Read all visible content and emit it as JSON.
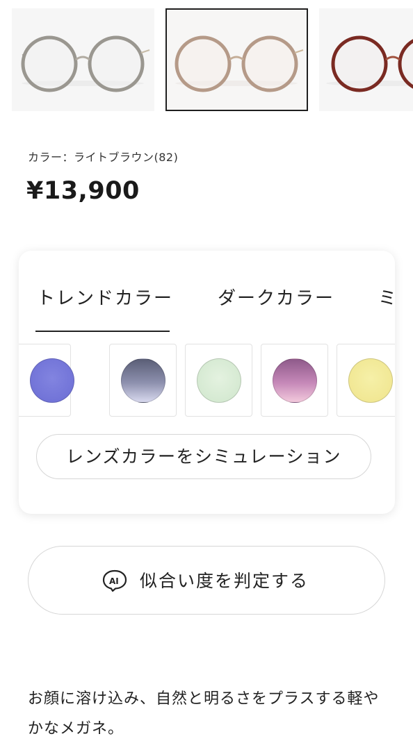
{
  "thumbnails": [
    {
      "name": "glasses-gray",
      "selected": false,
      "frame_color": "#9a9790"
    },
    {
      "name": "glasses-light-brown",
      "selected": true,
      "frame_color": "#b59a88"
    },
    {
      "name": "glasses-tortoise",
      "selected": false,
      "frame_color": "#7a2a22"
    }
  ],
  "product": {
    "color_line": "カラー：ライトブラウン(82)",
    "price": "¥13,900"
  },
  "lens_panel": {
    "tabs": [
      {
        "label": "トレンドカラー",
        "active": true
      },
      {
        "label": "ダークカラー",
        "active": false
      },
      {
        "label": "ミ",
        "active": false
      }
    ],
    "swatches": [
      {
        "name": "blue-violet",
        "color": "#7476db"
      },
      {
        "name": "gray-gradient",
        "color": "#6f7290"
      },
      {
        "name": "light-green",
        "color": "#d9ecd5"
      },
      {
        "name": "purple-pink-gradient",
        "color": "#b57aa8"
      },
      {
        "name": "light-yellow",
        "color": "#f2e89a"
      }
    ],
    "simulate_button": "レンズカラーをシミュレーション"
  },
  "ai_button": {
    "icon": "ai-chat-icon",
    "icon_text": "AI",
    "label": "似合い度を判定する"
  },
  "description": "お顔に溶け込み、自然と明るさをプラスする軽やかなメガネ。"
}
